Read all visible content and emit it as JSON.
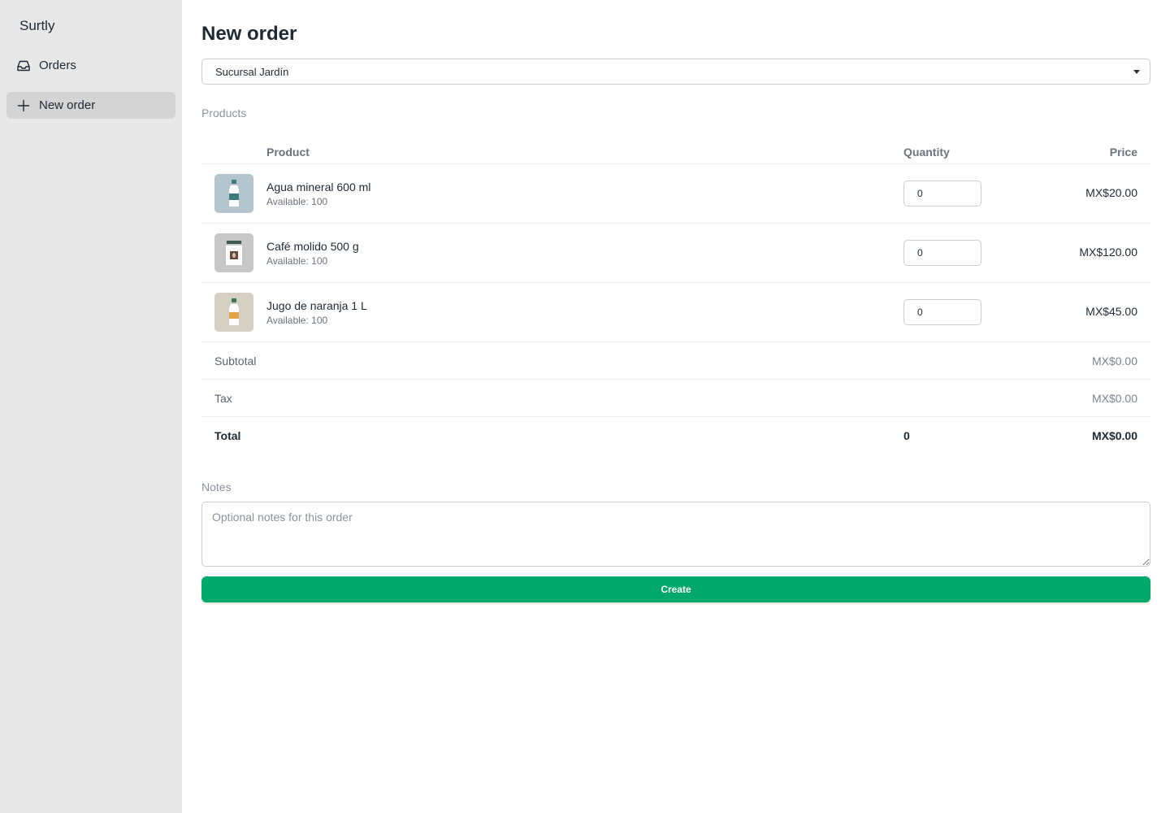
{
  "sidebar": {
    "brand": "Surtly",
    "items": [
      {
        "label": "Orders",
        "icon": "inbox-icon"
      },
      {
        "label": "New order",
        "icon": "plus-icon",
        "active": true
      }
    ]
  },
  "main": {
    "title": "New order",
    "branch_select": {
      "value": "Sucursal Jardín"
    },
    "products_label": "Products",
    "table": {
      "headers": {
        "product": "Product",
        "quantity": "Quantity",
        "price": "Price"
      },
      "rows": [
        {
          "name": "Agua mineral 600 ml",
          "available": "Available: 100",
          "quantity": "0",
          "price": "MX$20.00",
          "icon": "water-bottle-icon",
          "thumb_bg": "#b4c4cc",
          "accent": "#3d7a7e"
        },
        {
          "name": "Café molido 500 g",
          "available": "Available: 100",
          "quantity": "0",
          "price": "MX$120.00",
          "icon": "coffee-jar-icon",
          "thumb_bg": "#c7c7c7",
          "accent": "#6b4a3a"
        },
        {
          "name": "Jugo de naranja 1 L",
          "available": "Available: 100",
          "quantity": "0",
          "price": "MX$45.00",
          "icon": "juice-bottle-icon",
          "thumb_bg": "#d5cfc4",
          "accent": "#e3a444"
        }
      ]
    },
    "summary": {
      "subtotal_label": "Subtotal",
      "subtotal": "MX$0.00",
      "tax_label": "Tax",
      "tax": "MX$0.00",
      "total_label": "Total",
      "total_qty": "0",
      "total": "MX$0.00"
    },
    "notes": {
      "label": "Notes",
      "placeholder": "Optional notes for this order",
      "value": ""
    },
    "create_label": "Create"
  },
  "colors": {
    "accent": "#00a86b",
    "sidebar_bg": "#e8e8e8",
    "active_item_bg": "#d4d4d4"
  }
}
